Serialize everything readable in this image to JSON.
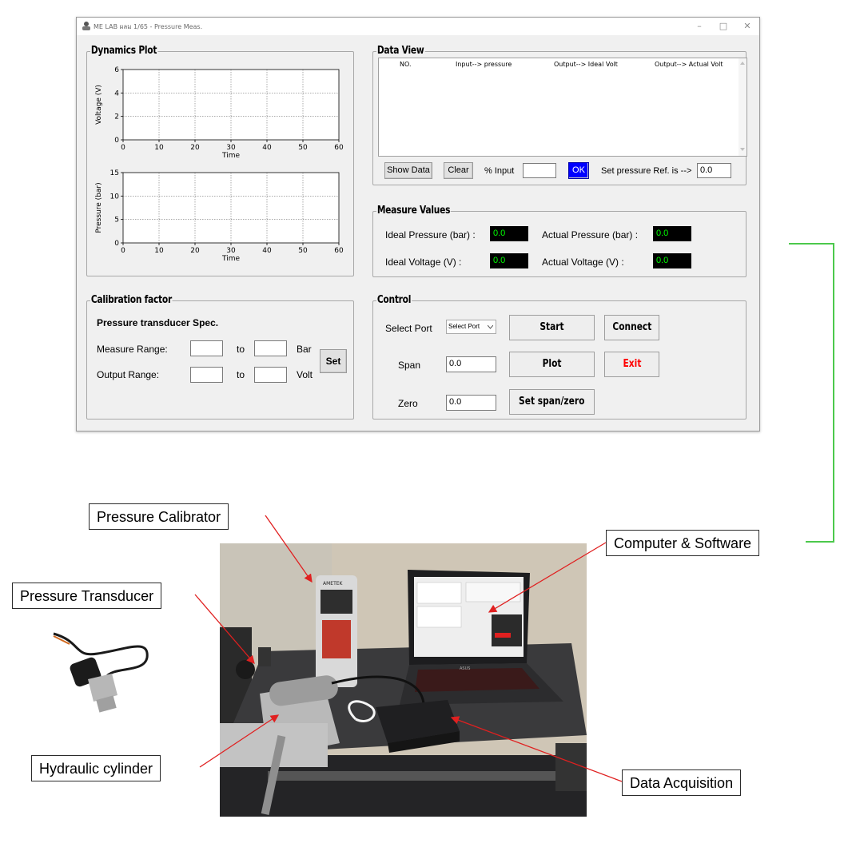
{
  "window": {
    "title": "ME LAB ผลม 1/65 - Pressure Meas.",
    "controls": {
      "minimize": "–",
      "maximize": "□",
      "close": "✕"
    }
  },
  "dynamics_plot": {
    "title": "Dynamics Plot",
    "voltage_plot": {
      "ylabel": "Voltage (V)",
      "xlabel": "Time",
      "yticks": [
        "0",
        "2",
        "4",
        "6"
      ],
      "xticks": [
        "0",
        "10",
        "20",
        "30",
        "40",
        "50",
        "60"
      ]
    },
    "pressure_plot": {
      "ylabel": "Pressure (bar)",
      "xlabel": "Time",
      "yticks": [
        "0",
        "5",
        "10",
        "15"
      ],
      "xticks": [
        "0",
        "10",
        "20",
        "30",
        "40",
        "50",
        "60"
      ]
    }
  },
  "chart_data": [
    {
      "type": "line",
      "title": "",
      "xlabel": "Time",
      "ylabel": "Voltage (V)",
      "xlim": [
        0,
        60
      ],
      "ylim": [
        0,
        6
      ],
      "grid": true,
      "series": []
    },
    {
      "type": "line",
      "title": "",
      "xlabel": "Time",
      "ylabel": "Pressure (bar)",
      "xlim": [
        0,
        60
      ],
      "ylim": [
        0,
        15
      ],
      "grid": true,
      "series": []
    }
  ],
  "data_view": {
    "title": "Data View",
    "columns": [
      "NO.",
      "Input--> pressure",
      "Output--> Ideal Volt",
      "Output--> Actual Volt"
    ],
    "rows": [],
    "show_data_label": "Show Data",
    "clear_label": "Clear",
    "percent_input_label": "% Input",
    "percent_input_value": "",
    "ok_label": "OK",
    "set_pressure_label": "Set pressure Ref. is -->",
    "set_pressure_value": "0.0"
  },
  "measure_values": {
    "title": "Measure Values",
    "ideal_pressure_label": "Ideal Pressure (bar) :",
    "ideal_pressure_value": "0.0",
    "actual_pressure_label": "Actual Pressure (bar) :",
    "actual_pressure_value": "0.0",
    "ideal_voltage_label": "Ideal Voltage (V) :",
    "ideal_voltage_value": "0.0",
    "actual_voltage_label": "Actual Voltage (V) :",
    "actual_voltage_value": "0.0"
  },
  "calibration": {
    "title": "Calibration factor",
    "spec_heading": "Pressure transducer Spec.",
    "measure_range_label": "Measure Range:",
    "output_range_label": "Output Range:",
    "to_label": "to",
    "bar_unit": "Bar",
    "volt_unit": "Volt",
    "set_label": "Set",
    "measure_min": "",
    "measure_max": "",
    "output_min": "",
    "output_max": ""
  },
  "control": {
    "title": "Control",
    "select_port_label": "Select Port",
    "select_port_value": "Select Port",
    "start_label": "Start",
    "connect_label": "Connect",
    "span_label": "Span",
    "span_value": "0.0",
    "plot_label": "Plot",
    "exit_label": "Exit",
    "zero_label": "Zero",
    "zero_value": "0.0",
    "set_span_zero_label": "Set span/zero"
  },
  "callouts": {
    "pressure_calibrator": "Pressure Calibrator",
    "pressure_transducer": "Pressure Transducer",
    "computer_software": "Computer & Software",
    "hydraulic_cylinder": "Hydraulic cylinder",
    "data_acquisition": "Data Acquisition"
  },
  "photo_text": {
    "brand": "AMETEK",
    "laptop_brand": "ASUS"
  },
  "colors": {
    "lcd_bg": "#000000",
    "lcd_text": "#00ff00",
    "ok_button": "#0000ff",
    "exit_text": "#ff0000",
    "connector_line": "#4cc94c",
    "arrow": "#e02020"
  }
}
